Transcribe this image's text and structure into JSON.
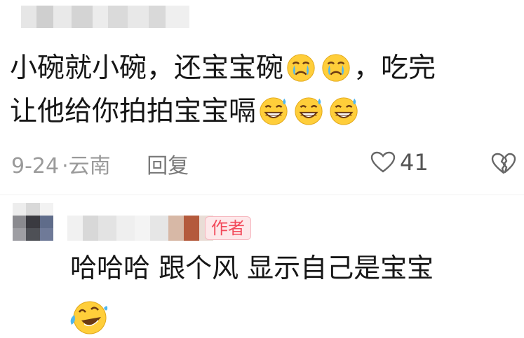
{
  "comment": {
    "line1_a": "小碗就小碗，还宝宝碗",
    "line1_b": "，吃完",
    "line2": "让他给你拍拍宝宝嗝",
    "emoji_line1": [
      "crying-face-icon",
      "crying-face-icon"
    ],
    "emoji_line2": [
      "grin-sweat-icon",
      "grin-sweat-icon",
      "grin-sweat-icon"
    ],
    "date": "9-24",
    "location": "云南",
    "separator": "·",
    "reply_label": "回复",
    "like_count": "41"
  },
  "reply": {
    "badge": "作者",
    "text": "哈哈哈 跟个风 显示自己是宝宝",
    "emoji": "laughing-tears-icon"
  },
  "colors": {
    "badge_text": "#f24a5b",
    "badge_bg": "#fde8ea",
    "meta_gray": "#9a9a9a"
  }
}
